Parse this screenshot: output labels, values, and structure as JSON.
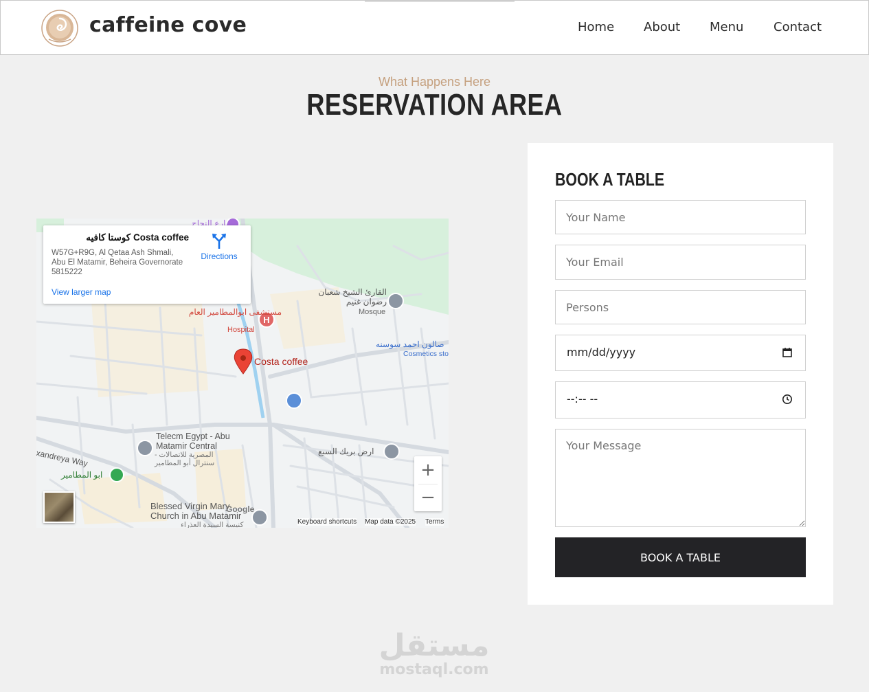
{
  "header": {
    "brand": "caffeine cove",
    "nav": [
      "Home",
      "About",
      "Menu",
      "Contact"
    ]
  },
  "section": {
    "subtitle": "What Happens Here",
    "title": "RESERVATION AREA"
  },
  "map": {
    "place_name": "كوستا كافيه Costa coffee",
    "address": "W57G+R9G, Al Qetaa Ash Shmali, Abu El Matamir, Beheira Governorate 5815222",
    "directions_label": "Directions",
    "larger_map_link": "View larger map",
    "labels": {
      "pin": "Costa coffee",
      "hospital_ar": "مستشفى ابوالمطامير العام",
      "hospital_en": "Hospital",
      "mosque_ar": "القارئ الشيخ شعبان رضوان غنيم",
      "mosque_en": "Mosque",
      "cosmetics_ar": "صالون احمد سوسنه",
      "cosmetics_en": "Cosmetics store",
      "telecom_en": "Telecm Egypt - Abu Matamir Central",
      "telecom_ar": "المصرية للاتصالات - سنترال أبو المطامير",
      "church_en": "Blessed Virgin Mary Church in Abu Matamir",
      "church_ar": "كنيسة السيدة العذراء",
      "road": "Alexandreya Way",
      "town_ar": "ابو المطامير",
      "land_ar": "ارض بريك السبع",
      "top_ar": "شارع النجاح",
      "google": "Google"
    },
    "attribution": {
      "keyboard": "Keyboard shortcuts",
      "data": "Map data ©2025",
      "terms": "Terms"
    },
    "zoom_in": "+",
    "zoom_out": "−"
  },
  "form": {
    "title": "BOOK A TABLE",
    "name_placeholder": "Your Name",
    "email_placeholder": "Your Email",
    "persons_placeholder": "Persons",
    "date_value": "mm/dd/yyyy",
    "time_value": "--:-- --",
    "message_placeholder": "Your Message",
    "submit_label": "BOOK A TABLE"
  },
  "watermark": {
    "arabic": "مستقل",
    "latin": "mostaql.com"
  },
  "colors": {
    "accent": "#c5a07e",
    "button": "#232326",
    "link": "#1a73e8",
    "pin": "#ea4335"
  }
}
